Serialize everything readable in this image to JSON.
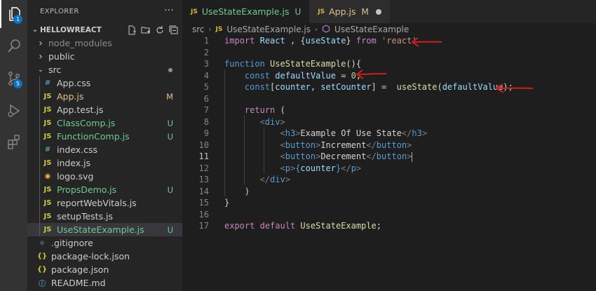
{
  "activity_bar": {
    "explorer_badge": "1",
    "scm_badge": "5"
  },
  "sidebar": {
    "header": "EXPLORER",
    "more": "···",
    "project": "HELLOWREACT",
    "tree": [
      {
        "label": "node_modules",
        "kind": "folder",
        "expanded": false,
        "indent": 1,
        "color": "#8c8c8c",
        "status": ""
      },
      {
        "label": "public",
        "kind": "folder",
        "expanded": false,
        "indent": 1,
        "color": "#cccccc",
        "status": ""
      },
      {
        "label": "src",
        "kind": "folder",
        "expanded": true,
        "indent": 1,
        "color": "#cccccc",
        "status": "dot"
      },
      {
        "label": "App.css",
        "kind": "css",
        "indent": 2,
        "color": "#cccccc",
        "status": ""
      },
      {
        "label": "App.js",
        "kind": "js",
        "indent": 2,
        "color": "#e2c08d",
        "status": "M"
      },
      {
        "label": "App.test.js",
        "kind": "js",
        "indent": 2,
        "color": "#cccccc",
        "status": ""
      },
      {
        "label": "ClassComp.js",
        "kind": "js",
        "indent": 2,
        "color": "#73c991",
        "status": "U"
      },
      {
        "label": "FunctionComp.js",
        "kind": "js",
        "indent": 2,
        "color": "#73c991",
        "status": "U"
      },
      {
        "label": "index.css",
        "kind": "css",
        "indent": 2,
        "color": "#cccccc",
        "status": ""
      },
      {
        "label": "index.js",
        "kind": "js",
        "indent": 2,
        "color": "#cccccc",
        "status": ""
      },
      {
        "label": "logo.svg",
        "kind": "svg",
        "indent": 2,
        "color": "#cccccc",
        "status": ""
      },
      {
        "label": "PropsDemo.js",
        "kind": "js",
        "indent": 2,
        "color": "#73c991",
        "status": "U"
      },
      {
        "label": "reportWebVitals.js",
        "kind": "js",
        "indent": 2,
        "color": "#cccccc",
        "status": ""
      },
      {
        "label": "setupTests.js",
        "kind": "js",
        "indent": 2,
        "color": "#cccccc",
        "status": ""
      },
      {
        "label": "UseStateExample.js",
        "kind": "js",
        "indent": 2,
        "color": "#73c991",
        "status": "U",
        "selected": true
      },
      {
        "label": ".gitignore",
        "kind": "git",
        "indent": 1,
        "color": "#cccccc",
        "status": ""
      },
      {
        "label": "package-lock.json",
        "kind": "json",
        "indent": 1,
        "color": "#cccccc",
        "status": ""
      },
      {
        "label": "package.json",
        "kind": "json",
        "indent": 1,
        "color": "#cccccc",
        "status": ""
      },
      {
        "label": "README.md",
        "kind": "md",
        "indent": 1,
        "color": "#cccccc",
        "status": ""
      }
    ]
  },
  "tabs": [
    {
      "icon": "JS",
      "label": "UseStateExample.js",
      "status": "U",
      "active": true
    },
    {
      "icon": "JS",
      "label": "App.js",
      "status": "M",
      "active": false
    }
  ],
  "breadcrumb": {
    "folder": "src",
    "file_icon": "JS",
    "file": "UseStateExample.js",
    "symbol": "UseStateExample"
  },
  "code": {
    "current_line": 11,
    "lines": [
      {
        "n": "1",
        "tokens": [
          [
            "kw2",
            "import"
          ],
          [
            "pun",
            " "
          ],
          [
            "var",
            "React"
          ],
          [
            "pun",
            " , {"
          ],
          [
            "var",
            "useState"
          ],
          [
            "pun",
            "} "
          ],
          [
            "kw2",
            "from"
          ],
          [
            "pun",
            " "
          ],
          [
            "str",
            "'react'"
          ]
        ]
      },
      {
        "n": "2",
        "tokens": []
      },
      {
        "n": "3",
        "tokens": [
          [
            "kw",
            "function"
          ],
          [
            "pun",
            " "
          ],
          [
            "fn",
            "UseStateExample"
          ],
          [
            "pun",
            "(){"
          ]
        ]
      },
      {
        "n": "4",
        "tokens": [
          [
            "pun",
            "    "
          ],
          [
            "kw",
            "const"
          ],
          [
            "pun",
            " "
          ],
          [
            "var",
            "defaultValue"
          ],
          [
            "pun",
            " = "
          ],
          [
            "num",
            "0"
          ],
          [
            "pun",
            ";"
          ]
        ]
      },
      {
        "n": "5",
        "tokens": [
          [
            "pun",
            "    "
          ],
          [
            "kw",
            "const"
          ],
          [
            "pun",
            "["
          ],
          [
            "var",
            "counter"
          ],
          [
            "pun",
            ", "
          ],
          [
            "var",
            "setCounter"
          ],
          [
            "pun",
            "] =  "
          ],
          [
            "fn",
            "useState"
          ],
          [
            "pun",
            "("
          ],
          [
            "var",
            "defaultValue"
          ],
          [
            "pun",
            ");"
          ]
        ]
      },
      {
        "n": "6",
        "tokens": []
      },
      {
        "n": "7",
        "tokens": [
          [
            "pun",
            "    "
          ],
          [
            "kw2",
            "return"
          ],
          [
            "pun",
            " ("
          ]
        ]
      },
      {
        "n": "8",
        "tokens": [
          [
            "pun",
            "       "
          ],
          [
            "brk",
            "<"
          ],
          [
            "tag",
            "div"
          ],
          [
            "brk",
            ">"
          ]
        ]
      },
      {
        "n": "9",
        "tokens": [
          [
            "pun",
            "           "
          ],
          [
            "brk",
            "<"
          ],
          [
            "tag",
            "h3"
          ],
          [
            "brk",
            ">"
          ],
          [
            "pun",
            "Example Of Use State"
          ],
          [
            "brk",
            "</"
          ],
          [
            "tag",
            "h3"
          ],
          [
            "brk",
            ">"
          ]
        ]
      },
      {
        "n": "10",
        "tokens": [
          [
            "pun",
            "           "
          ],
          [
            "brk",
            "<"
          ],
          [
            "tag",
            "button"
          ],
          [
            "brk",
            ">"
          ],
          [
            "pun",
            "Increment"
          ],
          [
            "brk",
            "</"
          ],
          [
            "tag",
            "button"
          ],
          [
            "brk",
            ">"
          ]
        ]
      },
      {
        "n": "11",
        "tokens": [
          [
            "pun",
            "           "
          ],
          [
            "brk",
            "<"
          ],
          [
            "tag",
            "button"
          ],
          [
            "brk",
            ">"
          ],
          [
            "pun",
            "Decrement"
          ],
          [
            "brk",
            "</"
          ],
          [
            "tag",
            "button"
          ],
          [
            "brk",
            ">"
          ],
          [
            "cursor",
            ""
          ]
        ]
      },
      {
        "n": "12",
        "tokens": [
          [
            "pun",
            "           "
          ],
          [
            "brk",
            "<"
          ],
          [
            "tag",
            "p"
          ],
          [
            "brk",
            ">"
          ],
          [
            "kw",
            "{"
          ],
          [
            "var",
            "counter"
          ],
          [
            "kw",
            "}"
          ],
          [
            "brk",
            "</"
          ],
          [
            "tag",
            "p"
          ],
          [
            "brk",
            ">"
          ]
        ]
      },
      {
        "n": "13",
        "tokens": [
          [
            "pun",
            "       "
          ],
          [
            "brk",
            "</"
          ],
          [
            "tag",
            "div"
          ],
          [
            "brk",
            ">"
          ]
        ]
      },
      {
        "n": "14",
        "tokens": [
          [
            "pun",
            "    )"
          ]
        ]
      },
      {
        "n": "15",
        "tokens": [
          [
            "pun",
            "}"
          ]
        ]
      },
      {
        "n": "16",
        "tokens": []
      },
      {
        "n": "17",
        "tokens": [
          [
            "kw2",
            "export"
          ],
          [
            "pun",
            " "
          ],
          [
            "kw2",
            "default"
          ],
          [
            "pun",
            " "
          ],
          [
            "fn",
            "UseStateExample"
          ],
          [
            "pun",
            ";"
          ]
        ]
      }
    ]
  },
  "annotations": {
    "arrow_color": "#cc1e1e"
  }
}
